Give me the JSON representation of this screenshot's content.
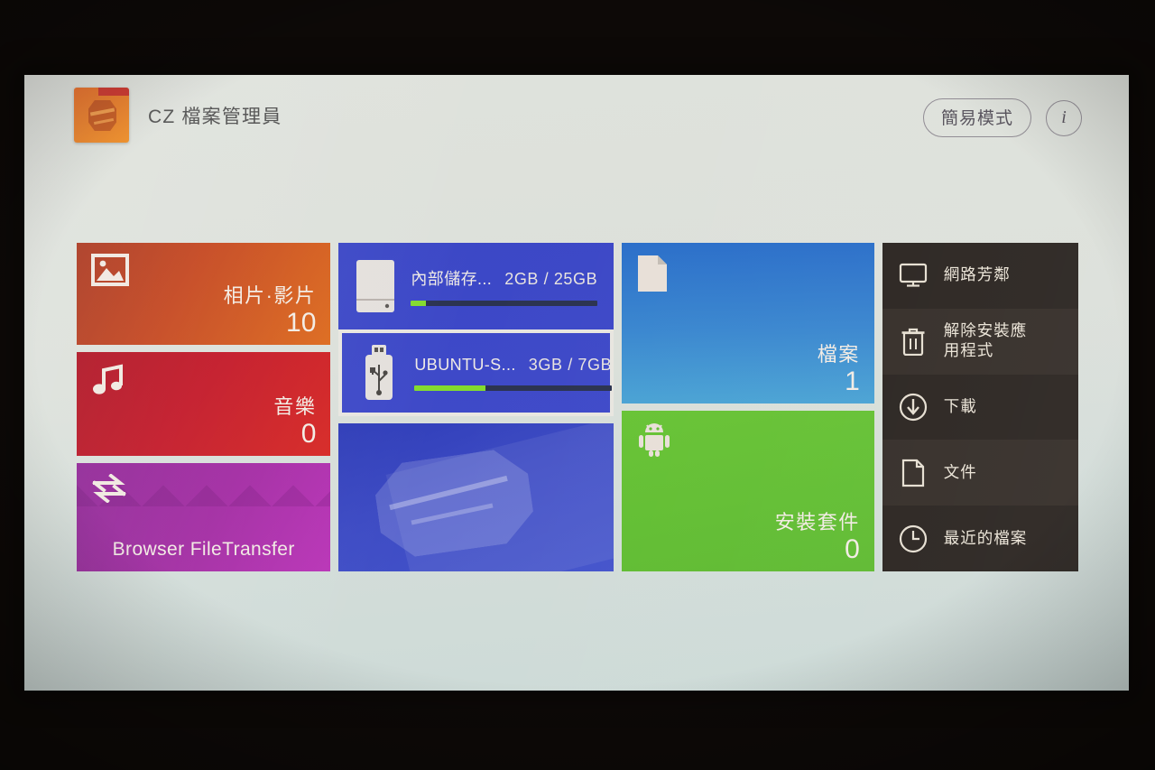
{
  "header": {
    "app_title": "CZ 檔案管理員",
    "app_icon": "cz-folder-icon",
    "simple_mode_label": "簡易模式",
    "info_label": "i"
  },
  "tiles": {
    "photos": {
      "name": "相片·影片",
      "count": "10",
      "icon": "image-icon",
      "color": "#c4441c"
    },
    "music": {
      "name": "音樂",
      "count": "0",
      "icon": "music-note-icon",
      "color": "#c21626"
    },
    "transfer": {
      "label": "Browser FileTransfer",
      "icon": "transfer-arrows-icon",
      "color": "#a32ba3"
    },
    "files": {
      "name": "檔案",
      "count": "1",
      "icon": "document-icon",
      "color": "#3a87cf"
    },
    "packages": {
      "name": "安裝套件",
      "count": "0",
      "icon": "android-robot-icon",
      "color": "#62be33"
    }
  },
  "storage": {
    "panel_color": "#3f4ac9",
    "items": [
      {
        "icon": "internal-drive-icon",
        "name": "內部儲存...",
        "size": "2GB / 25GB",
        "used_percent": 8,
        "selected": false
      },
      {
        "icon": "usb-drive-icon",
        "name": "UBUNTU-S...",
        "size": "3GB / 7GB",
        "used_percent": 36,
        "selected": true
      }
    ],
    "bar_fill_color": "#84dc2e"
  },
  "logo_panel": {
    "watermark": "cz-hexagon-logo"
  },
  "menu": {
    "background": "#2e2824",
    "items": [
      {
        "label": "網路芳鄰",
        "icon": "monitor-icon"
      },
      {
        "label": "解除安裝應\n用程式",
        "icon": "trash-icon"
      },
      {
        "label": "下載",
        "icon": "download-circle-icon"
      },
      {
        "label": "文件",
        "icon": "document-outline-icon"
      },
      {
        "label": "最近的檔案",
        "icon": "clock-icon"
      }
    ]
  }
}
